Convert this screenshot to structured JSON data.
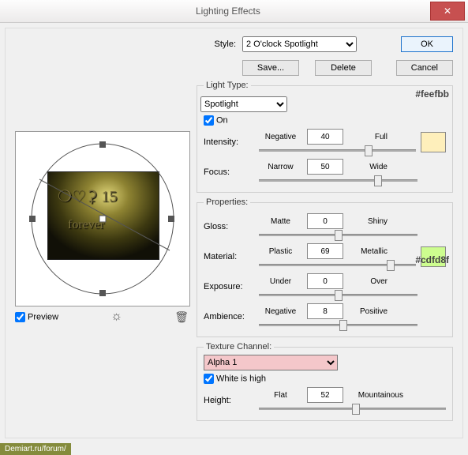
{
  "window": {
    "title": "Lighting Effects"
  },
  "buttons": {
    "ok": "OK",
    "cancel": "Cancel",
    "save": "Save...",
    "delete": "Delete"
  },
  "style": {
    "label": "Style:",
    "value": "2 O'clock Spotlight"
  },
  "lightType": {
    "legend": "Light Type:",
    "value": "Spotlight",
    "on_label": "On",
    "intensity": {
      "label": "Intensity:",
      "left": "Negative",
      "value": "40",
      "right": "Full",
      "pos": 70
    },
    "focus": {
      "label": "Focus:",
      "left": "Narrow",
      "value": "50",
      "right": "Wide",
      "pos": 75
    },
    "swatch": "#feefbb",
    "annot": "#feefbb"
  },
  "properties": {
    "legend": "Properties:",
    "gloss": {
      "label": "Gloss:",
      "left": "Matte",
      "value": "0",
      "right": "Shiny",
      "pos": 50
    },
    "material": {
      "label": "Material:",
      "left": "Plastic",
      "value": "69",
      "right": "Metallic",
      "pos": 84
    },
    "exposure": {
      "label": "Exposure:",
      "left": "Under",
      "value": "0",
      "right": "Over",
      "pos": 50
    },
    "ambience": {
      "label": "Ambience:",
      "left": "Negative",
      "value": "8",
      "right": "Positive",
      "pos": 53
    },
    "swatch": "#cdfd8f",
    "annot": "#cdfd8f"
  },
  "texture": {
    "legend": "Texture Channel:",
    "value": "Alpha 1",
    "white_label": "White is high",
    "height": {
      "label": "Height:",
      "left": "Flat",
      "value": "52",
      "right": "Mountainous",
      "pos": 52
    }
  },
  "preview": {
    "label": "Preview"
  },
  "watermark": "Demiart.ru/forum/"
}
